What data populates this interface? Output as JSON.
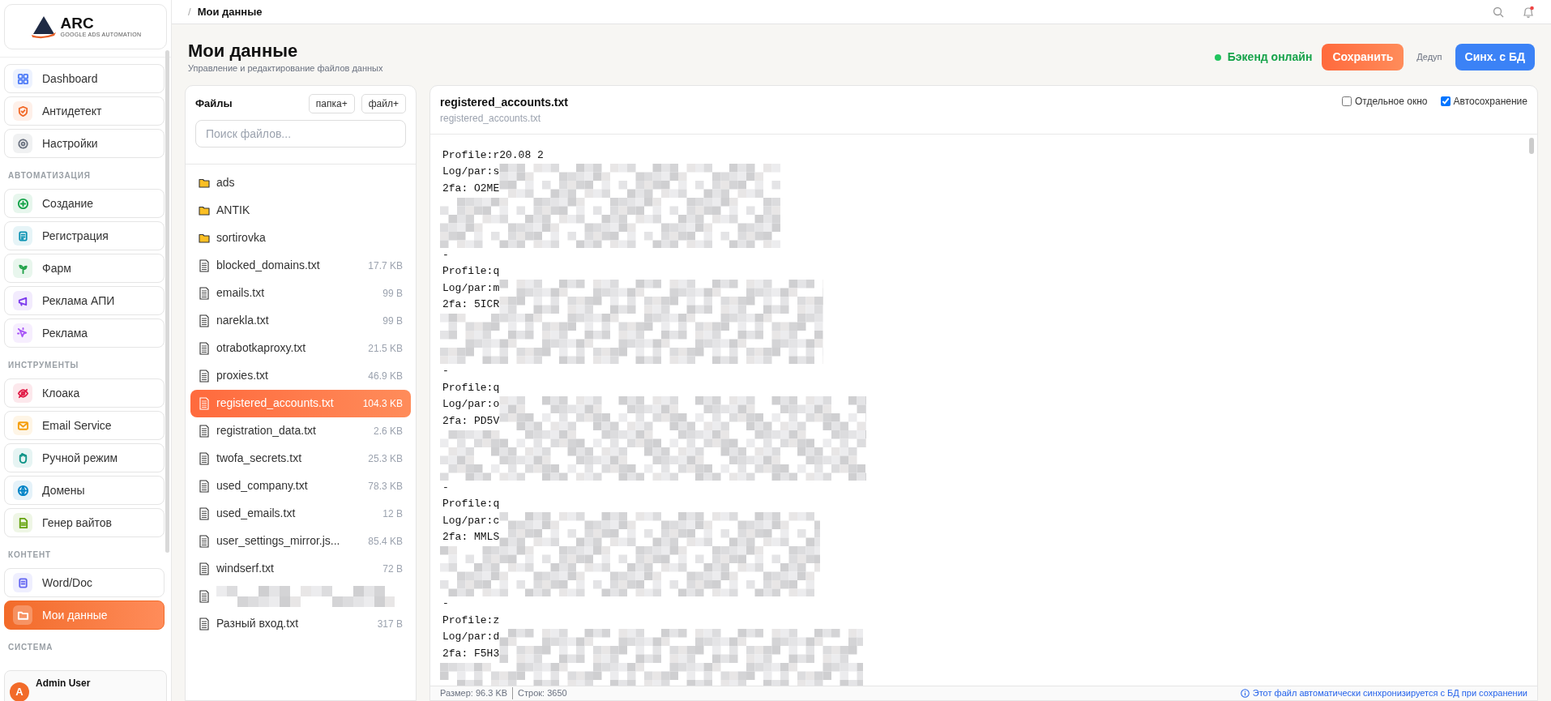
{
  "breadcrumb": {
    "separator": "/",
    "current": "Мои данные"
  },
  "sidebar": {
    "logo": {
      "name": "ARC",
      "tagline": "GOOGLE ADS AUTOMATION"
    },
    "groups": [
      {
        "items": [
          {
            "label": "Dashboard",
            "color": "#4f7cf7",
            "selected": false
          },
          {
            "label": "Антидетект",
            "color": "#f26b2a",
            "selected": false
          },
          {
            "label": "Настройки",
            "color": "#6b7280",
            "selected": false
          }
        ]
      },
      {
        "label": "АВТОМАТИЗАЦИЯ",
        "items": [
          {
            "label": "Создание",
            "color": "#16a34a",
            "selected": false
          },
          {
            "label": "Регистрация",
            "color": "#0891b2",
            "selected": false
          },
          {
            "label": "Фарм",
            "color": "#22a34a",
            "selected": false
          },
          {
            "label": "Реклама АПИ",
            "color": "#7c3aed",
            "selected": false
          },
          {
            "label": "Реклама",
            "color": "#a855f7",
            "selected": false
          }
        ]
      },
      {
        "label": "ИНСТРУМЕНТЫ",
        "items": [
          {
            "label": "Клоака",
            "color": "#e11d48",
            "selected": false
          },
          {
            "label": "Email Service",
            "color": "#f59e0b",
            "selected": false
          },
          {
            "label": "Ручной режим",
            "color": "#0d9488",
            "selected": false
          },
          {
            "label": "Домены",
            "color": "#0284c7",
            "selected": false
          },
          {
            "label": "Генер вайтов",
            "color": "#65a30d",
            "selected": false
          }
        ]
      },
      {
        "label": "КОНТЕНТ",
        "items": [
          {
            "label": "Word/Doc",
            "color": "#6366f1",
            "selected": false
          },
          {
            "label": "Мои данные",
            "color": "#f26b2a",
            "selected": true
          }
        ]
      },
      {
        "label": "СИСТЕМА"
      }
    ],
    "user": {
      "initial": "A",
      "name": "Admin User"
    }
  },
  "page": {
    "title": "Мои данные",
    "subtitle": "Управление и редактирование файлов данных"
  },
  "backend_status": {
    "label": "Бэкенд онлайн",
    "online": true
  },
  "actions": {
    "save": "Сохранить",
    "dedup": "Дедуп",
    "sync": "Синх. с БД"
  },
  "files": {
    "title": "Файлы",
    "buttons": [
      "папка+",
      "файл+"
    ],
    "search": {
      "placeholder": "Поиск файлов..."
    },
    "items": [
      {
        "kind": "folder",
        "name": "ads",
        "selected": false
      },
      {
        "kind": "folder",
        "name": "ANTIK",
        "selected": false
      },
      {
        "kind": "folder",
        "name": "sortirovka",
        "selected": false
      },
      {
        "kind": "file",
        "name": "blocked_domains.txt",
        "size": "17.7 KB",
        "selected": false
      },
      {
        "kind": "file",
        "name": "emails.txt",
        "size": "99 B",
        "selected": false
      },
      {
        "kind": "file",
        "name": "narekla.txt",
        "size": "99 B",
        "selected": false
      },
      {
        "kind": "file",
        "name": "otrabotkaproxy.txt",
        "size": "21.5 KB",
        "selected": false
      },
      {
        "kind": "file",
        "name": "proxies.txt",
        "size": "46.9 KB",
        "selected": false
      },
      {
        "kind": "file",
        "name": "registered_accounts.txt",
        "size": "104.3 KB",
        "selected": true
      },
      {
        "kind": "file",
        "name": "registration_data.txt",
        "size": "2.6 KB",
        "selected": false
      },
      {
        "kind": "file",
        "name": "twofa_secrets.txt",
        "size": "25.3 KB",
        "selected": false
      },
      {
        "kind": "file",
        "name": "used_company.txt",
        "size": "78.3 KB",
        "selected": false
      },
      {
        "kind": "file",
        "name": "used_emails.txt",
        "size": "12 B",
        "selected": false
      },
      {
        "kind": "file",
        "name": "user_settings_mirror.js...",
        "size": "85.4 KB",
        "selected": false
      },
      {
        "kind": "file",
        "name": "windserf.txt",
        "size": "72 B",
        "selected": false
      },
      {
        "kind": "redacted",
        "selected": false
      },
      {
        "kind": "file",
        "name": "Разный вход.txt",
        "size": "317 B",
        "selected": false
      }
    ]
  },
  "editor": {
    "title": "registered_accounts.txt",
    "path": "registered_accounts.txt",
    "options": [
      {
        "label": "Отдельное окно",
        "checked": false
      },
      {
        "label": "Автосохранение",
        "checked": true
      }
    ],
    "records": [
      {
        "lines": [
          "Profile:r20.08 2",
          "Log/par:s",
          "2fa: O2ME"
        ]
      },
      {
        "lines": [
          "Profile:q",
          "Log/par:m",
          "2fa: 5ICR"
        ]
      },
      {
        "lines": [
          "Profile:q",
          "Log/par:o",
          "2fa: PD5V"
        ]
      },
      {
        "lines": [
          "Profile:q",
          "Log/par:c",
          "2fa: MMLS"
        ]
      },
      {
        "lines": [
          "Profile:z",
          "Log/par:d",
          "2fa: F5H3"
        ]
      }
    ],
    "separator": "-",
    "footer": {
      "size": "Размер: 96.3 KB",
      "lines": "Строк: 3650",
      "note": "Этот файл автоматически синхронизируется с БД при сохранении"
    }
  }
}
